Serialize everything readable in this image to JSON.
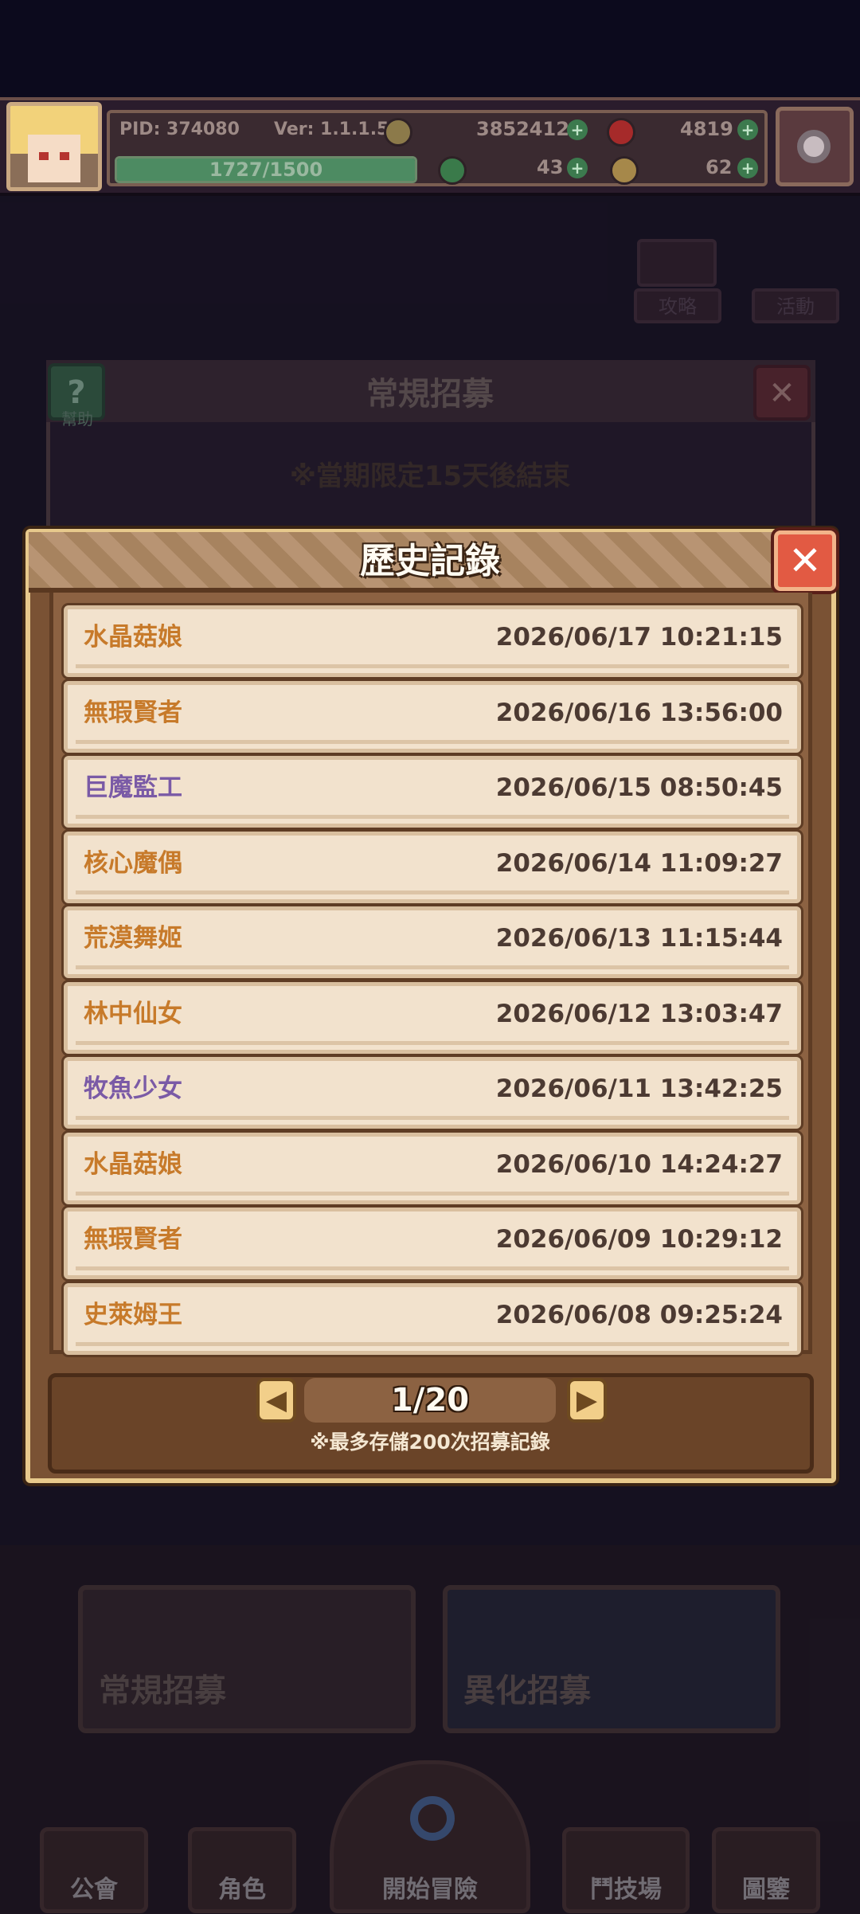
{
  "status_bar": {
    "pid": "PID: 374080",
    "version": "Ver: 1.1.1.5",
    "gold": "3852412",
    "gems": "4819",
    "xp": "1727/1500",
    "xp_fraction": 1.0,
    "clover": "43",
    "fist": "62"
  },
  "background": {
    "recruit_title": "常規招募",
    "help_label": "幫助",
    "limit_note": "※當期限定15天後結束",
    "strategy_label": "攻略",
    "event_label": "活動",
    "card_normal": "常規招募",
    "card_mutant": "異化招募",
    "nav": [
      "公會",
      "角色",
      "開始冒險",
      "鬥技場",
      "圖鑒"
    ]
  },
  "modal": {
    "title": "歷史記錄",
    "close_label": "✕",
    "records": [
      {
        "name": "水晶菇娘",
        "time": "2026/06/17 10:21:15",
        "rarity": "gold"
      },
      {
        "name": "無瑕賢者",
        "time": "2026/06/16 13:56:00",
        "rarity": "gold"
      },
      {
        "name": "巨魔監工",
        "time": "2026/06/15 08:50:45",
        "rarity": "purple"
      },
      {
        "name": "核心魔偶",
        "time": "2026/06/14 11:09:27",
        "rarity": "gold"
      },
      {
        "name": "荒漠舞姬",
        "time": "2026/06/13 11:15:44",
        "rarity": "gold"
      },
      {
        "name": "林中仙女",
        "time": "2026/06/12 13:03:47",
        "rarity": "gold"
      },
      {
        "name": "牧魚少女",
        "time": "2026/06/11 13:42:25",
        "rarity": "purple"
      },
      {
        "name": "水晶菇娘",
        "time": "2026/06/10 14:24:27",
        "rarity": "gold"
      },
      {
        "name": "無瑕賢者",
        "time": "2026/06/09 10:29:12",
        "rarity": "gold"
      },
      {
        "name": "史萊姆王",
        "time": "2026/06/08 09:25:24",
        "rarity": "gold"
      }
    ],
    "page": "1/20",
    "note": "※最多存儲200次招募記錄",
    "prev_label": "◀",
    "next_label": "▶"
  },
  "colors": {
    "gold_name": "#c77a2a",
    "purple_name": "#7a5aa6"
  }
}
